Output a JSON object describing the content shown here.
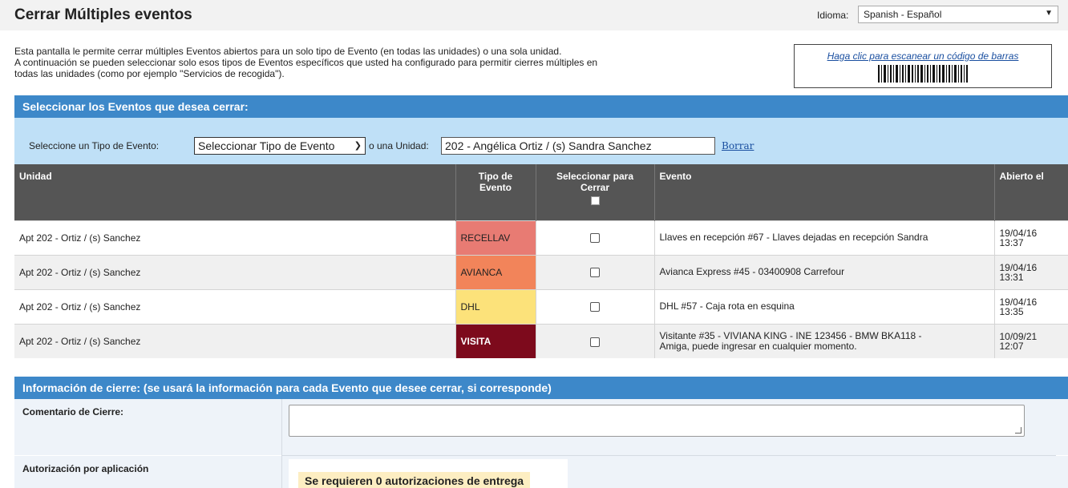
{
  "header": {
    "title": "Cerrar Múltiples eventos",
    "language_label": "Idioma:",
    "language_value": "Spanish - Español"
  },
  "intro": {
    "line1": "Esta pantalla le permite cerrar múltiples Eventos abiertos para un solo tipo de Evento (en todas las unidades) o una sola unidad.",
    "line2": "A continuación se pueden seleccionar solo esos tipos de Eventos específicos que usted ha configurado para permitir cierres múltiples en",
    "line3": "todas las unidades (como por ejemplo \"Servicios de recogida\")."
  },
  "barcode": {
    "link_text": "Haga clic para escanear un código de barras"
  },
  "select_section": {
    "title": "Seleccionar los Eventos que desea cerrar:",
    "type_label": "Seleccione un Tipo de Evento:",
    "type_value": "Seleccionar Tipo de Evento",
    "or_unit_label": "o una Unidad:",
    "unit_value": "202 - Angélica Ortiz / (s) Sandra Sanchez",
    "clear_link": "Borrar"
  },
  "table": {
    "headers": {
      "unit": "Unidad",
      "type_line1": "Tipo de",
      "type_line2": "Evento",
      "select_line1": "Seleccionar para",
      "select_line2": "Cerrar",
      "event": "Evento",
      "opened": "Abierto el"
    },
    "rows": [
      {
        "unit": "Apt 202 - Ortiz / (s) Sanchez",
        "type": "RECELLAV",
        "type_bg": "#e87b73",
        "type_fg": "#222222",
        "event": "Llaves en recepción #67 - Llaves dejadas en recepción Sandra",
        "date": "19/04/16",
        "time": "13:37"
      },
      {
        "unit": "Apt 202 - Ortiz / (s) Sanchez",
        "type": "AVIANCA",
        "type_bg": "#f2845a",
        "type_fg": "#222222",
        "event": "Avianca Express #45 - 03400908 Carrefour",
        "date": "19/04/16",
        "time": "13:31"
      },
      {
        "unit": "Apt 202 - Ortiz / (s) Sanchez",
        "type": "DHL",
        "type_bg": "#fce27a",
        "type_fg": "#222222",
        "event": "DHL #57 - Caja rota en esquina",
        "date": "19/04/16",
        "time": "13:35"
      },
      {
        "unit": "Apt 202 - Ortiz / (s) Sanchez",
        "type": "VISITA",
        "type_bg": "#7d0a1c",
        "type_fg": "#ffffff",
        "event_line1": "Visitante #35 - VIVIANA KING - INE 123456 - BMW BKA118 -",
        "event_line2": "Amiga, puede ingresar en cualquier momento.",
        "date": "10/09/21",
        "time": "12:07"
      }
    ]
  },
  "close_section": {
    "title": "Información de cierre: (se usará la información para cada Evento que desee cerrar, si corresponde)",
    "comment_label": "Comentario de Cierre:",
    "auth_label": "Autorización por aplicación",
    "auth_required": "Se requieren 0 autorizaciones de entrega"
  },
  "colors": {
    "header_blue": "#3d88c9",
    "filter_bg": "#bfe0f7",
    "table_header": "#555555",
    "link": "#1a4fa0"
  }
}
